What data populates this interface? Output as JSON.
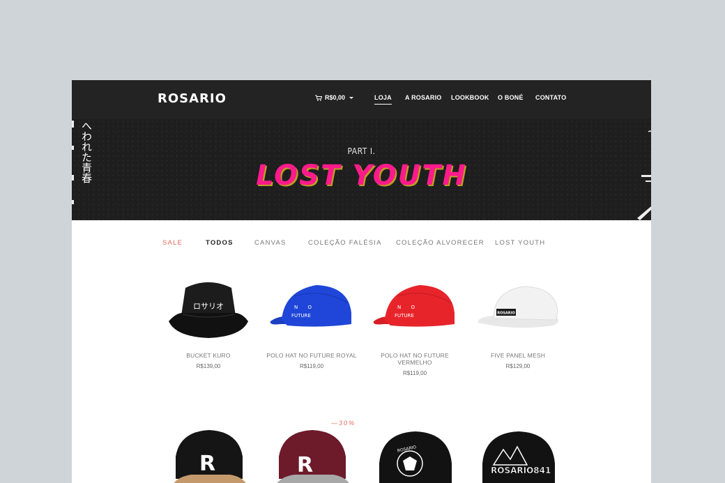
{
  "nav": {
    "logo": "ROSARIO",
    "cart_total": "R$0,00",
    "links": [
      "LOJA",
      "A ROSARIO",
      "LOOKBOOK",
      "O BONÉ",
      "CONTATO"
    ]
  },
  "hero": {
    "vertical_text": "へわれた青春",
    "subtitle": "PART I.",
    "title": "LOST YOUTH"
  },
  "categories": [
    "SALE",
    "TODOS",
    "CANVAS",
    "COLEÇÃO FALÉSIA",
    "COLEÇÃO ALVORECER",
    "LOST YOUTH"
  ],
  "products": [
    {
      "name": "BUCKET KURO",
      "price": "R$139,00",
      "cap_text": "ロサリオ"
    },
    {
      "name": "POLO HAT NO FUTURE ROYAL",
      "price": "R$119,00",
      "cap_text": "N O FUTURE"
    },
    {
      "name": "POLO HAT NO FUTURE VERMELHO",
      "price": "R$119,00",
      "cap_text": "N O FUTURE"
    },
    {
      "name": "FIVE PANEL MESH",
      "price": "R$129,00",
      "cap_text": "ROSARIO"
    }
  ],
  "row2": {
    "discount_badge": "—30%",
    "cap_texts": [
      "R",
      "R",
      "ROSARIO",
      "ROSARIO841"
    ]
  },
  "colors": {
    "nav_bg": "#232323",
    "hero_title": "#ff1a8c",
    "sale": "#e4685a",
    "page_bg": "#cfd4d9"
  }
}
